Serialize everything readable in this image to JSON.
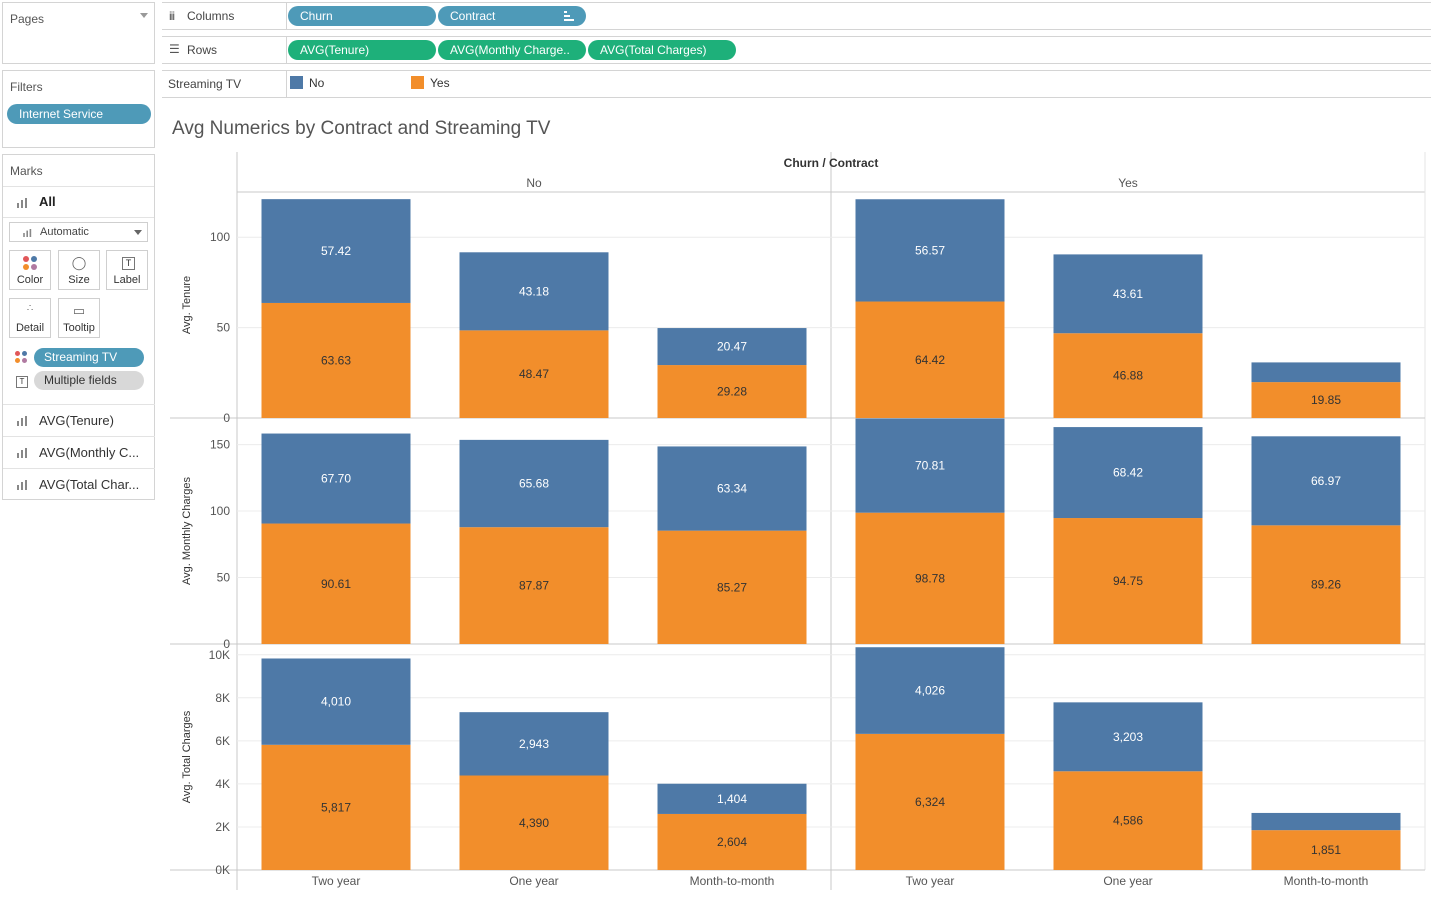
{
  "pages_card": {
    "title": "Pages"
  },
  "filters_card": {
    "title": "Filters",
    "pills": [
      "Internet Service"
    ]
  },
  "marks_card": {
    "title": "Marks",
    "all_label": "All",
    "mark_type": "Automatic",
    "buttons": {
      "color": "Color",
      "size": "Size",
      "label": "Label",
      "detail": "Detail",
      "tooltip": "Tooltip"
    },
    "color_pill": "Streaming TV",
    "label_pill": "Multiple fields",
    "measures": [
      "AVG(Tenure)",
      "AVG(Monthly C...",
      "AVG(Total Char..."
    ]
  },
  "shelves": {
    "columns_label": "Columns",
    "columns": [
      "Churn",
      "Contract"
    ],
    "rows_label": "Rows",
    "rows": [
      "AVG(Tenure)",
      "AVG(Monthly Charge..",
      "AVG(Total Charges)"
    ]
  },
  "legend": {
    "title": "Streaming TV",
    "items": [
      {
        "label": "No",
        "color": "#4e79a7"
      },
      {
        "label": "Yes",
        "color": "#f28e2b"
      }
    ]
  },
  "chart_data": {
    "type": "bar",
    "stacked": true,
    "title": "Avg Numerics by Contract and Streaming TV",
    "column_header": "Churn  /  Contract",
    "panes": [
      "No",
      "Yes"
    ],
    "categories": [
      "Two year",
      "One year",
      "Month-to-month"
    ],
    "rows": [
      {
        "label": "Avg. Tenure",
        "ylim": [
          0,
          125
        ],
        "ticks": [
          {
            "v": 0,
            "t": "0"
          },
          {
            "v": 50,
            "t": "50"
          },
          {
            "v": 100,
            "t": "100"
          }
        ],
        "yes": [
          [
            63.63,
            48.47,
            29.28
          ],
          [
            64.42,
            46.88,
            19.85
          ]
        ],
        "no": [
          [
            57.42,
            43.18,
            20.47
          ],
          [
            56.57,
            43.61,
            10.9
          ]
        ],
        "yes_labels": [
          [
            "63.63",
            "48.47",
            "29.28"
          ],
          [
            "64.42",
            "46.88",
            "19.85"
          ]
        ],
        "no_labels": [
          [
            "57.42",
            "43.18",
            "20.47"
          ],
          [
            "56.57",
            "43.61",
            ""
          ]
        ]
      },
      {
        "label": "Avg. Monthly Charges",
        "ylim": [
          0,
          170
        ],
        "ticks": [
          {
            "v": 0,
            "t": "0"
          },
          {
            "v": 50,
            "t": "50"
          },
          {
            "v": 100,
            "t": "100"
          },
          {
            "v": 150,
            "t": "150"
          }
        ],
        "yes": [
          [
            90.61,
            87.87,
            85.27
          ],
          [
            98.78,
            94.75,
            89.26
          ]
        ],
        "no": [
          [
            67.7,
            65.68,
            63.34
          ],
          [
            70.81,
            68.42,
            66.97
          ]
        ],
        "yes_labels": [
          [
            "90.61",
            "87.87",
            "85.27"
          ],
          [
            "98.78",
            "94.75",
            "89.26"
          ]
        ],
        "no_labels": [
          [
            "67.70",
            "65.68",
            "63.34"
          ],
          [
            "70.81",
            "68.42",
            "66.97"
          ]
        ]
      },
      {
        "label": "Avg. Total Charges",
        "ylim": [
          0,
          10500
        ],
        "ticks": [
          {
            "v": 0,
            "t": "0K"
          },
          {
            "v": 2000,
            "t": "2K"
          },
          {
            "v": 4000,
            "t": "4K"
          },
          {
            "v": 6000,
            "t": "6K"
          },
          {
            "v": 8000,
            "t": "8K"
          },
          {
            "v": 10000,
            "t": "10K"
          }
        ],
        "yes": [
          [
            5817,
            4390,
            2604
          ],
          [
            6324,
            4586,
            1851
          ]
        ],
        "no": [
          [
            4010,
            2943,
            1404
          ],
          [
            4026,
            3203,
            800
          ]
        ],
        "yes_labels": [
          [
            "5,817",
            "4,390",
            "2,604"
          ],
          [
            "6,324",
            "4,586",
            "1,851"
          ]
        ],
        "no_labels": [
          [
            "4,010",
            "2,943",
            "1,404"
          ],
          [
            "4,026",
            "3,203",
            ""
          ]
        ]
      }
    ],
    "colors": {
      "No": "#4e79a7",
      "Yes": "#f28e2b"
    }
  }
}
